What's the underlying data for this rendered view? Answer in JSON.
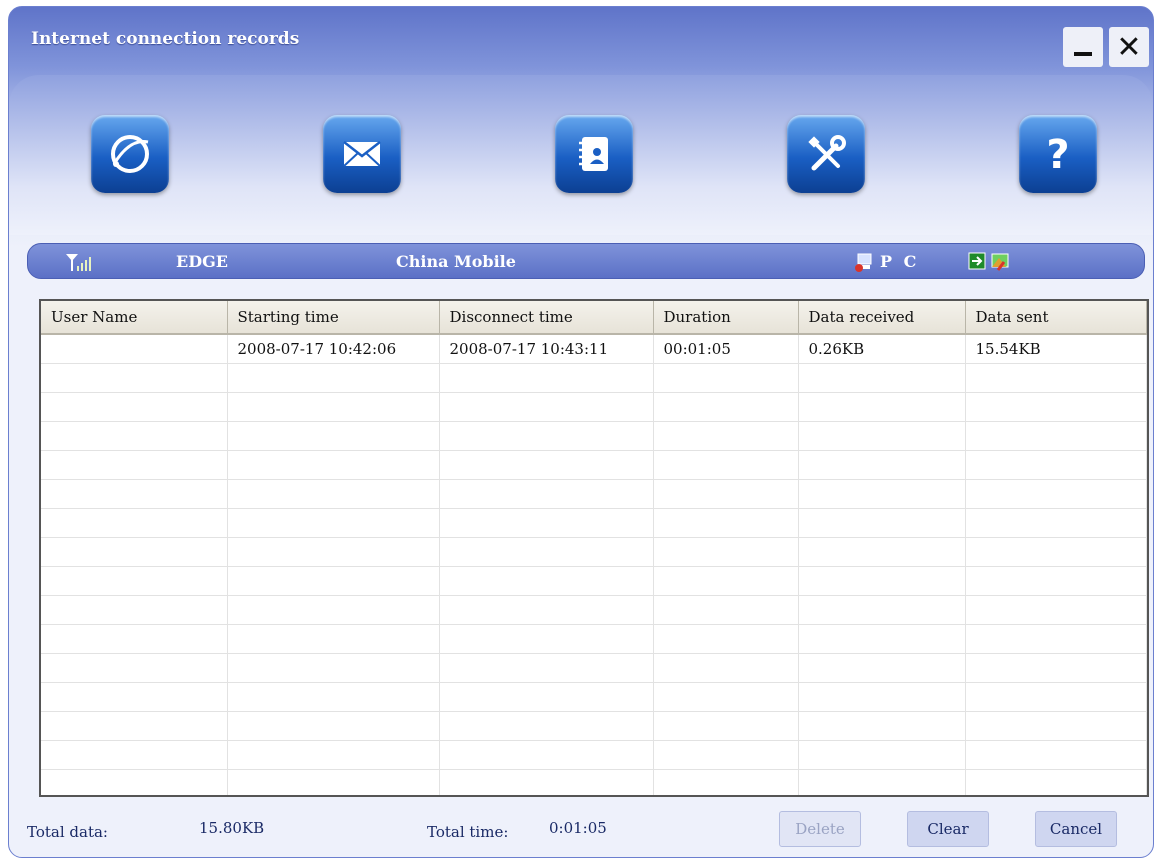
{
  "window": {
    "title": "Internet connection records",
    "minimize_glyph": "_",
    "close_glyph": "✕"
  },
  "toolbar": {
    "items": [
      {
        "icon": "globe-connect-icon"
      },
      {
        "icon": "envelope-icon"
      },
      {
        "icon": "address-book-icon"
      },
      {
        "icon": "tools-icon"
      },
      {
        "icon": "help-icon"
      }
    ]
  },
  "status": {
    "network_type": "EDGE",
    "operator": "China Mobile",
    "device_label": "P C"
  },
  "table": {
    "columns": [
      "User Name",
      "Starting time",
      "Disconnect time",
      "Duration",
      "Data received",
      "Data sent"
    ],
    "rows": [
      [
        "",
        "2008-07-17  10:42:06",
        "2008-07-17  10:43:11",
        "00:01:05",
        "0.26KB",
        "15.54KB"
      ]
    ]
  },
  "footer": {
    "total_data_label": "Total data:",
    "total_data_value": "15.80KB",
    "total_time_label": "Total time:",
    "total_time_value": "0:01:05",
    "delete_label": "Delete",
    "clear_label": "Clear",
    "cancel_label": "Cancel"
  },
  "colors": {
    "accent": "#5f74c9",
    "button_blue": "#1a5fc4"
  }
}
